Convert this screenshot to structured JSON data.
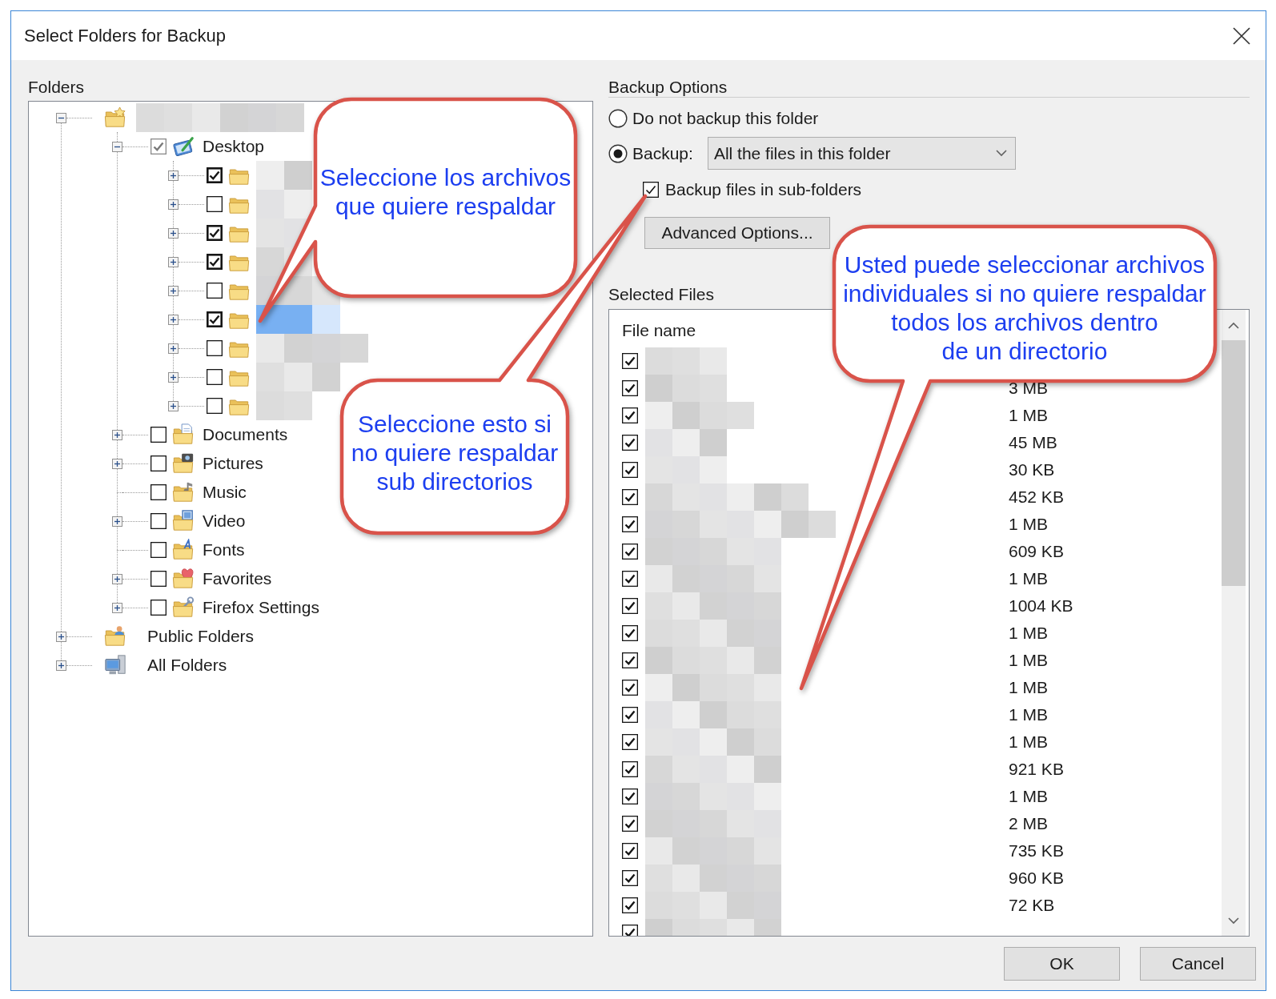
{
  "window": {
    "title": "Select Folders for Backup"
  },
  "folders": {
    "label": "Folders",
    "tree": [
      {
        "kind": "root",
        "expanded": true,
        "selected": false,
        "children": [
          {
            "kind": "desktop",
            "label": "Desktop",
            "expanded": true,
            "checked": true,
            "mixed": true,
            "selected": false,
            "children": [
              {
                "kind": "folder",
                "expanded": false,
                "checked": true,
                "mixed": false,
                "selected": false
              },
              {
                "kind": "folder",
                "expanded": false,
                "checked": false,
                "mixed": false,
                "selected": false
              },
              {
                "kind": "folder",
                "expanded": false,
                "checked": true,
                "mixed": false,
                "selected": false
              },
              {
                "kind": "folder",
                "expanded": false,
                "checked": true,
                "mixed": false,
                "selected": false
              },
              {
                "kind": "folder",
                "expanded": false,
                "checked": false,
                "mixed": false,
                "selected": false
              },
              {
                "kind": "folder",
                "expanded": false,
                "checked": true,
                "mixed": false,
                "selected": true
              },
              {
                "kind": "folder",
                "expanded": false,
                "checked": false,
                "mixed": false,
                "selected": false
              },
              {
                "kind": "folder",
                "expanded": false,
                "checked": false,
                "mixed": false,
                "selected": false
              },
              {
                "kind": "folder",
                "expanded": false,
                "checked": false,
                "mixed": false,
                "selected": false
              }
            ]
          },
          {
            "kind": "documents",
            "label": "Documents",
            "expanded": false,
            "checked": false,
            "mixed": false,
            "selected": false
          },
          {
            "kind": "pictures",
            "label": "Pictures",
            "expanded": false,
            "checked": false,
            "mixed": false,
            "selected": false
          },
          {
            "kind": "music",
            "label": "Music",
            "checked": false,
            "mixed": false,
            "selected": false
          },
          {
            "kind": "video",
            "label": "Video",
            "expanded": false,
            "checked": false,
            "mixed": false,
            "selected": false
          },
          {
            "kind": "fonts",
            "label": "Fonts",
            "checked": false,
            "mixed": false,
            "selected": false
          },
          {
            "kind": "favorites",
            "label": "Favorites",
            "expanded": false,
            "checked": false,
            "mixed": false,
            "selected": false
          },
          {
            "kind": "settings",
            "label": "Firefox Settings",
            "expanded": false,
            "checked": false,
            "mixed": false,
            "selected": false
          }
        ]
      },
      {
        "kind": "public",
        "label": "Public Folders",
        "expanded": false,
        "selected": false
      },
      {
        "kind": "computer",
        "label": "All Folders",
        "expanded": false,
        "selected": false
      }
    ]
  },
  "backup_options": {
    "heading": "Backup Options",
    "options": [
      {
        "kind": "plain",
        "label": "Do not backup this folder",
        "selected": false
      },
      {
        "kind": "dropdown",
        "label": "Backup:",
        "selected": true,
        "value": "All the files in this folder"
      }
    ],
    "subfolders": {
      "label": "Backup files in sub-folders",
      "checked": true
    },
    "advanced_button": "Advanced Options..."
  },
  "selected_files": {
    "label": "Selected Files",
    "columns": [
      "File name"
    ],
    "rows": [
      {
        "checked": true
      },
      {
        "checked": true,
        "size": "3 MB"
      },
      {
        "checked": true,
        "size": "1 MB"
      },
      {
        "checked": true,
        "size": "45 MB"
      },
      {
        "checked": true,
        "size": "30 KB"
      },
      {
        "checked": true,
        "size": "452 KB"
      },
      {
        "checked": true,
        "size": "1 MB"
      },
      {
        "checked": true,
        "size": "609 KB"
      },
      {
        "checked": true,
        "size": "1 MB"
      },
      {
        "checked": true,
        "size": "1004 KB"
      },
      {
        "checked": true,
        "size": "1 MB"
      },
      {
        "checked": true,
        "size": "1 MB"
      },
      {
        "checked": true,
        "size": "1 MB"
      },
      {
        "checked": true,
        "size": "1 MB"
      },
      {
        "checked": true,
        "size": "1 MB"
      },
      {
        "checked": true,
        "size": "921 KB"
      },
      {
        "checked": true,
        "size": "1 MB"
      },
      {
        "checked": true,
        "size": "2 MB"
      },
      {
        "checked": true,
        "size": "735 KB"
      },
      {
        "checked": true,
        "size": "960 KB"
      },
      {
        "checked": true,
        "size": "72 KB"
      },
      {
        "checked": true
      }
    ]
  },
  "callouts": [
    {
      "lines": [
        "Seleccione los archivos",
        "que quiere respaldar"
      ]
    },
    {
      "lines": [
        "Seleccione esto si",
        "no quiere respaldar",
        "sub directorios"
      ]
    },
    {
      "lines": [
        "Usted puede seleccionar archivos",
        "individuales si no quiere respaldar",
        "todos los archivos dentro",
        "de un directorio"
      ]
    }
  ],
  "buttons": [
    {
      "label": "OK"
    },
    {
      "label": "Cancel"
    }
  ]
}
